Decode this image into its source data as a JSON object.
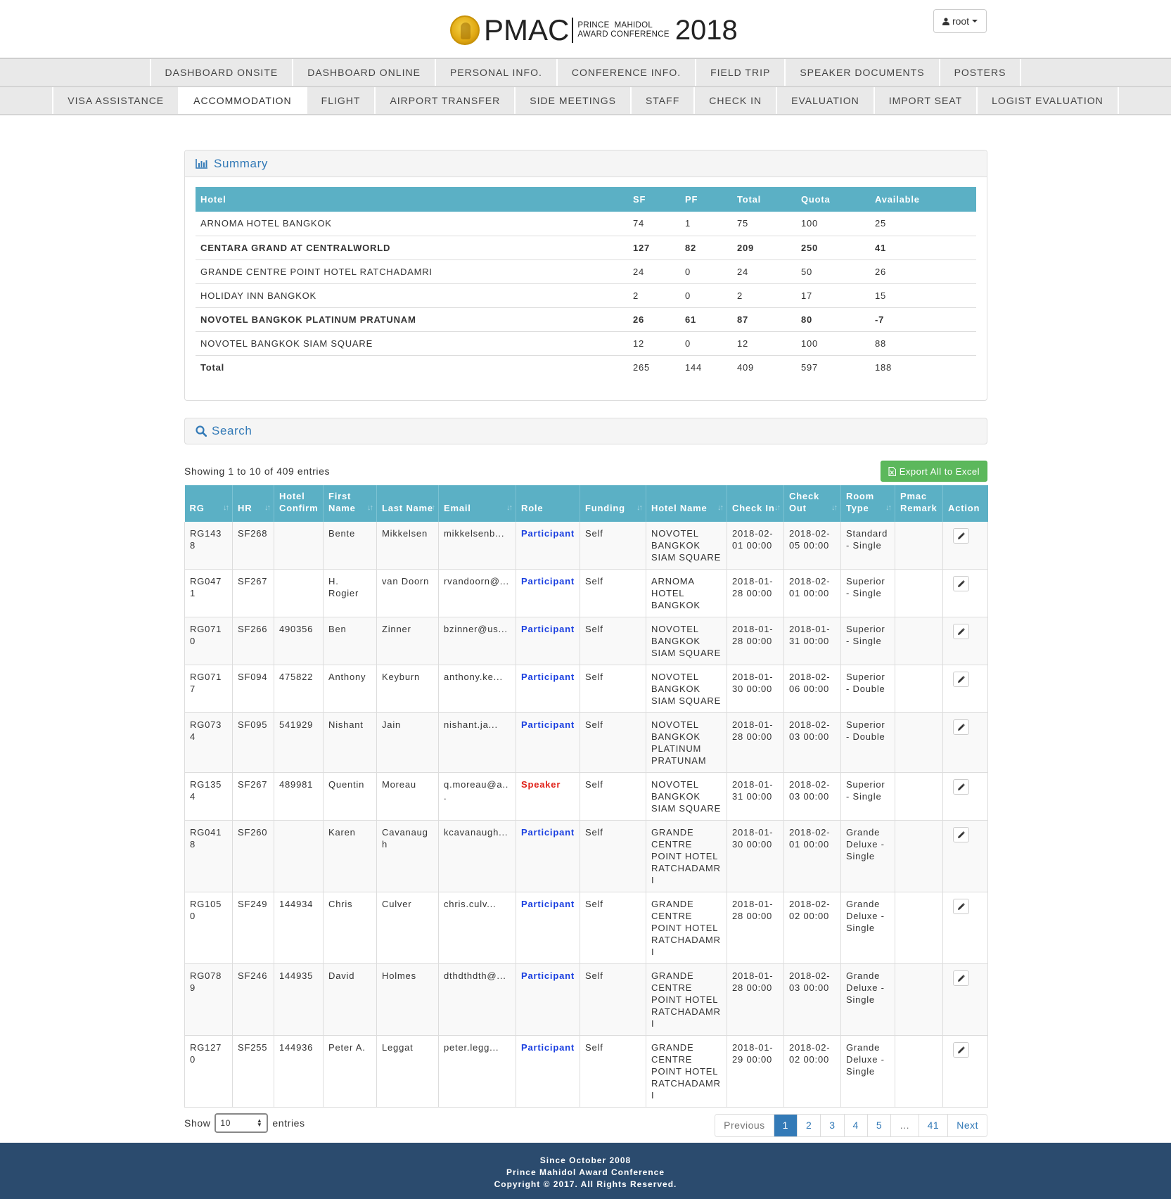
{
  "header": {
    "logo_text": "PMAC",
    "logo_sub_line1": "PRINCE  MAHIDOL",
    "logo_sub_line2": "AWARD CONFERENCE",
    "logo_year": "2018",
    "user_label": "root"
  },
  "nav": {
    "row1": [
      "DASHBOARD ONSITE",
      "DASHBOARD ONLINE",
      "PERSONAL INFO.",
      "CONFERENCE INFO.",
      "FIELD TRIP",
      "SPEAKER DOCUMENTS",
      "POSTERS"
    ],
    "row2": [
      "VISA ASSISTANCE",
      "ACCOMMODATION",
      "FLIGHT",
      "AIRPORT TRANSFER",
      "SIDE MEETINGS",
      "STAFF",
      "CHECK IN",
      "EVALUATION",
      "IMPORT SEAT",
      "LOGIST EVALUATION"
    ],
    "active": "ACCOMMODATION"
  },
  "summary": {
    "title": "Summary",
    "headers": [
      "Hotel",
      "SF",
      "PF",
      "Total",
      "Quota",
      "Available"
    ],
    "rows": [
      {
        "hotel": "ARNOMA HOTEL BANGKOK",
        "sf": "74",
        "pf": "1",
        "total": "75",
        "quota": "100",
        "available": "25",
        "bold": false
      },
      {
        "hotel": "CENTARA GRAND AT CENTRALWORLD",
        "sf": "127",
        "pf": "82",
        "total": "209",
        "quota": "250",
        "available": "41",
        "bold": true
      },
      {
        "hotel": "GRANDE CENTRE POINT HOTEL RATCHADAMRI",
        "sf": "24",
        "pf": "0",
        "total": "24",
        "quota": "50",
        "available": "26",
        "bold": false
      },
      {
        "hotel": "HOLIDAY INN BANGKOK",
        "sf": "2",
        "pf": "0",
        "total": "2",
        "quota": "17",
        "available": "15",
        "bold": false
      },
      {
        "hotel": "NOVOTEL BANGKOK PLATINUM PRATUNAM",
        "sf": "26",
        "pf": "61",
        "total": "87",
        "quota": "80",
        "available": "-7",
        "bold": true
      },
      {
        "hotel": "NOVOTEL BANGKOK SIAM SQUARE",
        "sf": "12",
        "pf": "0",
        "total": "12",
        "quota": "100",
        "available": "88",
        "bold": false
      }
    ],
    "total": {
      "hotel": "Total",
      "sf": "265",
      "pf": "144",
      "total": "409",
      "quota": "597",
      "available": "188"
    }
  },
  "search": {
    "title": "Search"
  },
  "table": {
    "info": "Showing 1 to 10 of 409 entries",
    "export_label": "Export All to Excel",
    "headers": [
      {
        "label": "RG",
        "sortable": true
      },
      {
        "label": "HR",
        "sortable": true
      },
      {
        "label": "Hotel Confirm",
        "sortable": false
      },
      {
        "label": "First Name",
        "sortable": true
      },
      {
        "label": "Last Name",
        "sortable": true
      },
      {
        "label": "Email",
        "sortable": true
      },
      {
        "label": "Role",
        "sortable": false
      },
      {
        "label": "Funding",
        "sortable": true
      },
      {
        "label": "Hotel Name",
        "sortable": true
      },
      {
        "label": "Check In",
        "sortable": true
      },
      {
        "label": "Check Out",
        "sortable": true
      },
      {
        "label": "Room Type",
        "sortable": true
      },
      {
        "label": "Pmac Remark",
        "sortable": false
      },
      {
        "label": "Action",
        "sortable": false
      }
    ],
    "rows": [
      {
        "rg": "RG1438",
        "hr": "SF268",
        "confirm": "",
        "first": "Bente",
        "last": "Mikkelsen",
        "email": "mikkelsenb...",
        "role": "Participant",
        "funding": "Self",
        "hotel": "NOVOTEL BANGKOK SIAM SQUARE",
        "check_in": "2018-02-01 00:00",
        "check_out": "2018-02-05 00:00",
        "room": "Standard - Single",
        "remark": ""
      },
      {
        "rg": "RG0471",
        "hr": "SF267",
        "confirm": "",
        "first": "H. Rogier",
        "last": "van Doorn",
        "email": "rvandoorn@...",
        "role": "Participant",
        "funding": "Self",
        "hotel": "ARNOMA HOTEL BANGKOK",
        "check_in": "2018-01-28 00:00",
        "check_out": "2018-02-01 00:00",
        "room": "Superior - Single",
        "remark": ""
      },
      {
        "rg": "RG0710",
        "hr": "SF266",
        "confirm": "490356",
        "first": "Ben",
        "last": "Zinner",
        "email": "bzinner@us...",
        "role": "Participant",
        "funding": "Self",
        "hotel": "NOVOTEL BANGKOK SIAM SQUARE",
        "check_in": "2018-01-28 00:00",
        "check_out": "2018-01-31 00:00",
        "room": "Superior - Single",
        "remark": ""
      },
      {
        "rg": "RG0717",
        "hr": "SF094",
        "confirm": "475822",
        "first": "Anthony",
        "last": "Keyburn",
        "email": "anthony.ke...",
        "role": "Participant",
        "funding": "Self",
        "hotel": "NOVOTEL BANGKOK SIAM SQUARE",
        "check_in": "2018-01-30 00:00",
        "check_out": "2018-02-06 00:00",
        "room": "Superior - Double",
        "remark": ""
      },
      {
        "rg": "RG0734",
        "hr": "SF095",
        "confirm": "541929",
        "first": "Nishant",
        "last": "Jain",
        "email": "nishant.ja...",
        "role": "Participant",
        "funding": "Self",
        "hotel": "NOVOTEL BANGKOK PLATINUM PRATUNAM",
        "check_in": "2018-01-28 00:00",
        "check_out": "2018-02-03 00:00",
        "room": "Superior - Double",
        "remark": ""
      },
      {
        "rg": "RG1354",
        "hr": "SF267",
        "confirm": "489981",
        "first": "Quentin",
        "last": "Moreau",
        "email": "q.moreau@a...",
        "role": "Speaker",
        "funding": "Self",
        "hotel": "NOVOTEL BANGKOK SIAM SQUARE",
        "check_in": "2018-01-31 00:00",
        "check_out": "2018-02-03 00:00",
        "room": "Superior - Single",
        "remark": ""
      },
      {
        "rg": "RG0418",
        "hr": "SF260",
        "confirm": "",
        "first": "Karen",
        "last": "Cavanaugh",
        "email": "kcavanaugh...",
        "role": "Participant",
        "funding": "Self",
        "hotel": "GRANDE CENTRE POINT HOTEL RATCHADAMRI",
        "check_in": "2018-01-30 00:00",
        "check_out": "2018-02-01 00:00",
        "room": "Grande Deluxe - Single",
        "remark": ""
      },
      {
        "rg": "RG1050",
        "hr": "SF249",
        "confirm": "144934",
        "first": "Chris",
        "last": "Culver",
        "email": "chris.culv...",
        "role": "Participant",
        "funding": "Self",
        "hotel": "GRANDE CENTRE POINT HOTEL RATCHADAMRI",
        "check_in": "2018-01-28 00:00",
        "check_out": "2018-02-02 00:00",
        "room": "Grande Deluxe - Single",
        "remark": ""
      },
      {
        "rg": "RG0789",
        "hr": "SF246",
        "confirm": "144935",
        "first": "David",
        "last": "Holmes",
        "email": "dthdthdth@...",
        "role": "Participant",
        "funding": "Self",
        "hotel": "GRANDE CENTRE POINT HOTEL RATCHADAMRI",
        "check_in": "2018-01-28 00:00",
        "check_out": "2018-02-03 00:00",
        "room": "Grande Deluxe - Single",
        "remark": ""
      },
      {
        "rg": "RG1270",
        "hr": "SF255",
        "confirm": "144936",
        "first": "Peter A.",
        "last": "Leggat",
        "email": "peter.legg...",
        "role": "Participant",
        "funding": "Self",
        "hotel": "GRANDE CENTRE POINT HOTEL RATCHADAMRI",
        "check_in": "2018-01-29 00:00",
        "check_out": "2018-02-02 00:00",
        "room": "Grande Deluxe - Single",
        "remark": ""
      }
    ],
    "show_label": "Show",
    "entries_label": "entries",
    "page_size": "10",
    "pagination": [
      "Previous",
      "1",
      "2",
      "3",
      "4",
      "5",
      "…",
      "41",
      "Next"
    ],
    "current_page": "1"
  },
  "footer": {
    "line1": "Since October 2008",
    "line2": "Prince Mahidol Award Conference",
    "line3": "Copyright © 2017. All Rights Reserved."
  },
  "colors": {
    "header_teal": "#5bb0c5",
    "link_blue": "#337ab7",
    "participant": "#1a3fe0",
    "speaker": "#e0221a",
    "export_green": "#5cb85c",
    "footer_navy": "#2b4b6e"
  }
}
